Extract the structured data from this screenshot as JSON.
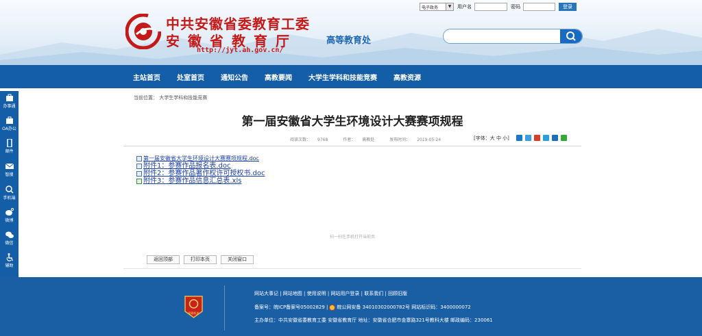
{
  "topbar": {
    "email_select": "电子政务",
    "username_label": "用户名",
    "username_value": "",
    "password_label": "密码",
    "password_value": "",
    "login_button": "登录"
  },
  "site": {
    "line1": "中共安徽省委教育工委",
    "line2": "安徽省教育厅",
    "url": "http://jyt.ah.gov.cn/",
    "department": "高等教育处",
    "brand_color": "#c41a1a",
    "accent_color": "#145ea8"
  },
  "search": {
    "placeholder": "",
    "value": ""
  },
  "nav": {
    "items": [
      {
        "label": "主站首页"
      },
      {
        "label": "处室首页"
      },
      {
        "label": "通知公告"
      },
      {
        "label": "高教要闻"
      },
      {
        "label": "大学生学科和技能竞赛"
      },
      {
        "label": "高教资源"
      }
    ]
  },
  "sidebar": {
    "items": [
      {
        "label": "办事通",
        "icon": "briefcase-icon"
      },
      {
        "label": "OA办公",
        "icon": "briefcase-icon"
      },
      {
        "label": "邮件",
        "icon": "mobile-icon"
      },
      {
        "label": "智搜",
        "icon": "mail-icon"
      },
      {
        "label": "手机端",
        "icon": "search-icon"
      },
      {
        "label": "微博",
        "icon": "weibo-icon"
      },
      {
        "label": "微信",
        "icon": "wechat-icon"
      },
      {
        "label": "辅助",
        "icon": "accessibility-icon"
      }
    ],
    "collapse": "‹"
  },
  "breadcrumb": {
    "prefix": "当前位置：",
    "current": "大学生学科和技能竞赛"
  },
  "article": {
    "title": "第一届安徽省大学生环境设计大赛赛项规程",
    "views_label": "阅读次数：",
    "views": "9768",
    "author_label": "作者：",
    "author": "高教处",
    "date_label": "发布时间：",
    "date": "2019-05-24",
    "font_size_label": "[字体：大 中 小]"
  },
  "attachments": [
    {
      "name": "第一届安徽省大学生环境设计大赛赛项规程.doc",
      "type": "doc"
    },
    {
      "name": "附件1：参赛作品报名表.doc",
      "type": "doc"
    },
    {
      "name": "附件2：参赛作品著作权许可授权书.doc",
      "type": "doc"
    },
    {
      "name": "附件3：参赛作品信息汇总表.xls",
      "type": "xls"
    }
  ],
  "qr_hint": "扫一扫在手机打开当前页",
  "actions": {
    "back_top": "返回顶部",
    "print": "打印本页",
    "close": "关闭窗口"
  },
  "footer": {
    "links": "网站大事记 | 网站地图 | 使用说明 | 网站用户登录 | 联系我们 | 回顾旧版",
    "icp": "备案号：皖ICP备案号05002829 |",
    "police": "皖公网安备 34010302000782号  网站标识码：3400000072",
    "host": "主办单位：中共安徽省委教育工委 安徽省教育厅  地址：安徽省合肥市金寨路321号教科大楼  邮政编码：230061",
    "badge_text": "党政机关"
  }
}
